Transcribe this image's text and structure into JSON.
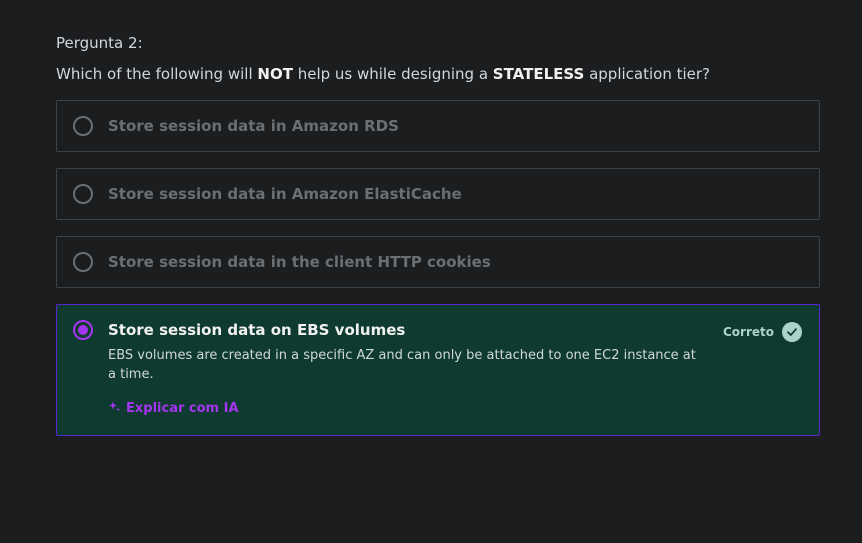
{
  "question": {
    "label": "Pergunta 2:",
    "text_parts": [
      "Which of the following will ",
      "NOT",
      " help us while designing a ",
      "STATELESS",
      " application tier?"
    ]
  },
  "options": [
    {
      "label": "Store session data in Amazon RDS"
    },
    {
      "label": "Store session data in Amazon ElastiCache"
    },
    {
      "label": "Store session data in the client HTTP cookies"
    },
    {
      "label": "Store session data on EBS volumes"
    }
  ],
  "selected_option": {
    "status": "Correto",
    "explanation": "EBS volumes are created in a specific AZ and can only be attached to one EC2 instance at a time.",
    "ai_link": "Explicar com IA"
  },
  "colors": {
    "background": "#1c1d1f",
    "correct_bg": "#0e3a2f",
    "accent": "#a435f0",
    "correct": "#acd2cc"
  }
}
